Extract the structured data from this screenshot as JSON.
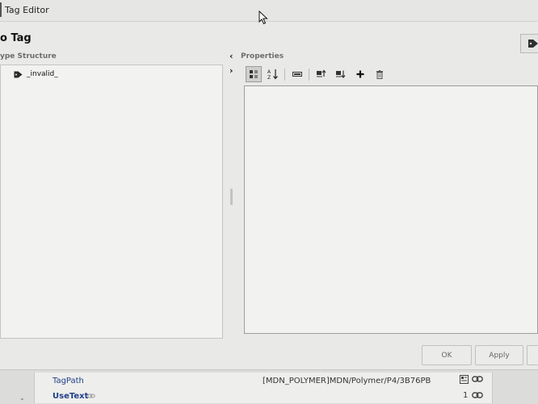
{
  "window": {
    "title": "Tag Editor"
  },
  "dialog": {
    "title": "o Tag"
  },
  "left": {
    "header": "ype Structure",
    "tree": [
      {
        "label": "_invalid_",
        "icon": "tag-icon"
      }
    ]
  },
  "right": {
    "header": "Properties",
    "toolbar": [
      {
        "name": "categorized-view-icon",
        "active": true
      },
      {
        "name": "sort-az-icon",
        "active": false
      },
      {
        "name": "property-pages-icon",
        "active": false
      },
      {
        "name": "move-up-icon",
        "active": false
      },
      {
        "name": "move-down-icon",
        "active": false
      },
      {
        "name": "add-icon",
        "active": false
      },
      {
        "name": "delete-icon",
        "active": false
      }
    ]
  },
  "buttons": {
    "ok": "OK",
    "apply": "Apply"
  },
  "bottom": {
    "rows": [
      {
        "name": "TagPath",
        "value": "[MDN_POLYMER]MDN/Polymer/P4/3B76PB",
        "extra": ""
      },
      {
        "name": "UseText",
        "value": "",
        "extra": "1"
      }
    ]
  }
}
